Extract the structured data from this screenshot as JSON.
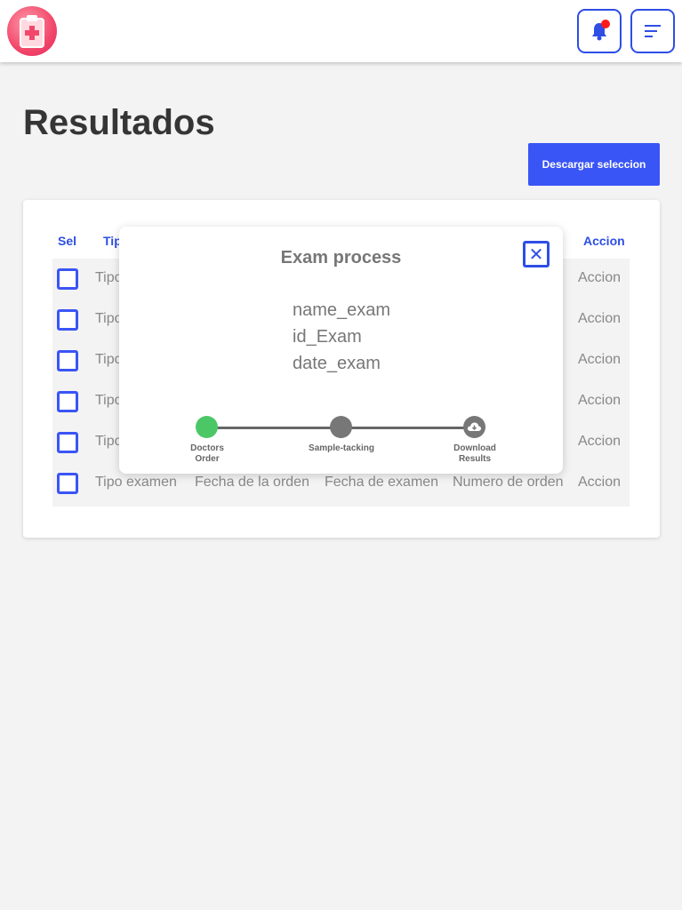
{
  "header": {
    "logo_icon": "medical-clipboard-icon",
    "bell_icon": "bell-icon",
    "menu_icon": "menu-icon",
    "accent_color": "#2e4ee6"
  },
  "page": {
    "title": "Resultados",
    "download_label": "Descargar seleccion"
  },
  "table": {
    "headers": {
      "sel": "Sel",
      "tipo": "Tip",
      "accion": "Accion"
    },
    "rows": [
      {
        "tipo": "Tipo",
        "fecha_orden": "",
        "fecha_examen": "",
        "numero": "",
        "accion": "Accion"
      },
      {
        "tipo": "Tipo",
        "fecha_orden": "",
        "fecha_examen": "",
        "numero": "",
        "accion": "Accion"
      },
      {
        "tipo": "Tipo",
        "fecha_orden": "",
        "fecha_examen": "",
        "numero": "",
        "accion": "Accion"
      },
      {
        "tipo": "Tipo",
        "fecha_orden": "",
        "fecha_examen": "",
        "numero": "",
        "accion": "Accion"
      },
      {
        "tipo": "Tipo",
        "fecha_orden": "",
        "fecha_examen": "",
        "numero": "",
        "accion": "Accion"
      },
      {
        "tipo": "Tipo examen",
        "fecha_orden": "Fecha de la orden",
        "fecha_examen": "Fecha de examen",
        "numero": "Numero de orden",
        "accion": "Accion"
      }
    ]
  },
  "modal": {
    "title": "Exam process",
    "close_label": "✕",
    "name_exam": "name_exam",
    "id_exam": "id_Exam",
    "date_exam": "date_exam",
    "steps": [
      {
        "label1": "Doctors",
        "label2": "Order",
        "status_color": "#4cc766"
      },
      {
        "label1": "Sample-tacking",
        "label2": "",
        "status_color": "#777777"
      },
      {
        "label1": "Download",
        "label2": "Results",
        "icon": "cloud-download-icon",
        "status_color": "#777777"
      }
    ]
  }
}
